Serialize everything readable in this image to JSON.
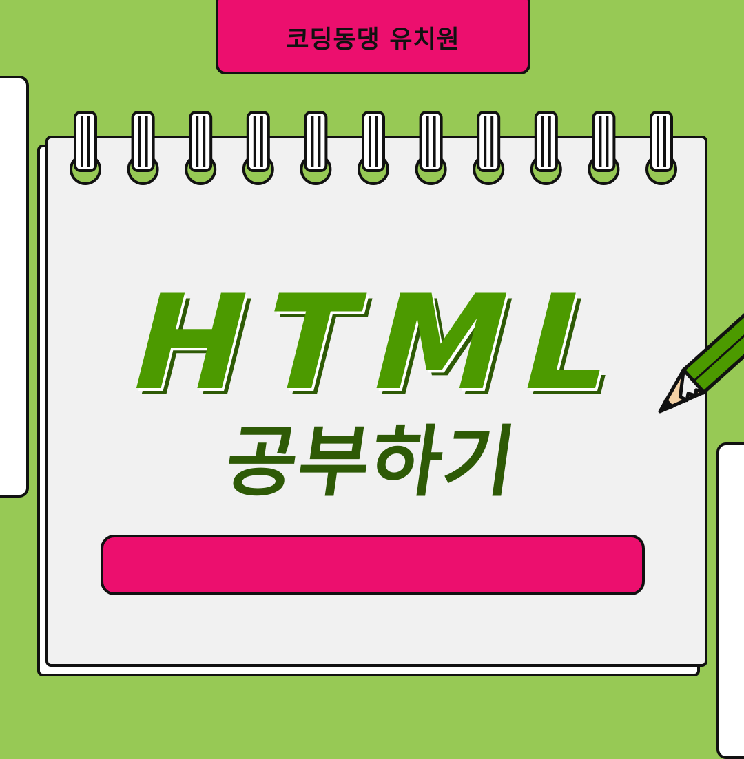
{
  "header": {
    "tab_label": "코딩동댕 유치원"
  },
  "main": {
    "title": "HTML",
    "subtitle": "공부하기"
  },
  "colors": {
    "background": "#97c955",
    "accent_pink": "#ec0f6e",
    "title_green": "#4c9a00",
    "subtitle_green": "#2e5a06",
    "paper": "#f1f1f1"
  },
  "icons": {
    "binding": "spiral-ring-icon",
    "pencil": "pencil-icon"
  }
}
